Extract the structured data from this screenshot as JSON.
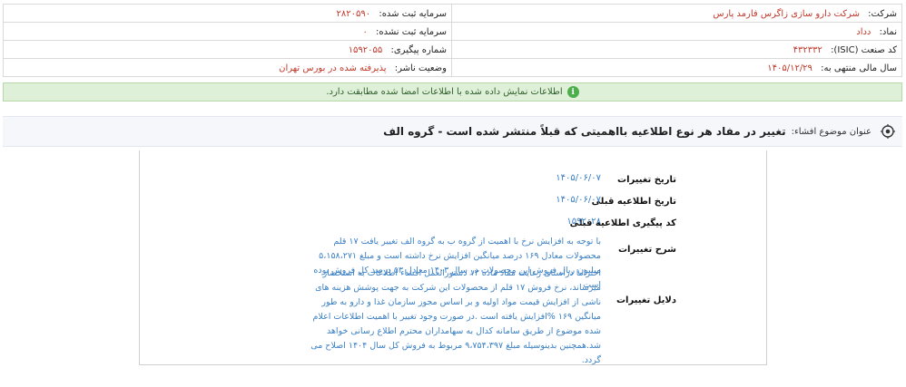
{
  "company_info": {
    "company_label": "شرکت:",
    "company_value": "شرکت دارو سازی زاگرس فارمد پارس",
    "registered_capital_label": "سرمایه ثبت شده:",
    "registered_capital_value": "۲۸۲۰۵۹۰",
    "symbol_label": "نماد:",
    "symbol_value": "دداد",
    "unregistered_capital_label": "سرمایه ثبت نشده:",
    "unregistered_capital_value": "۰",
    "isic_label": "کد صنعت (ISIC):",
    "isic_value": "۴۳۲۳۳۲",
    "tracking_label": "شماره پیگیری:",
    "tracking_value": "۱۵۹۲۰۵۵",
    "fiscal_year_label": "سال مالی منتهی به:",
    "fiscal_year_value": "۱۴۰۵/۱۲/۲۹",
    "publisher_status_label": "وضعیت ناشر:",
    "publisher_status_value": "پذیرفته شده در بورس تهران"
  },
  "notice": {
    "icon": "info-icon",
    "text": "اطلاعات نمایش داده شده با اطلاعات امضا شده مطابقت دارد."
  },
  "subject": {
    "label": "عنوان موضوع افشاء:",
    "title": "تغییر در مفاد هر نوع اطلاعیه بااهمیتی که قبلاً منتشر شده است - گروه الف"
  },
  "details": {
    "change_date_label": "تاریخ تغییرات",
    "change_date_value": "۱۴۰۵/۰۶/۰۷",
    "prev_notice_date_label": "تاریخ اطلاعیه قبلی",
    "prev_notice_date_value": "۱۴۰۵/۰۶/۰۷",
    "prev_tracking_label": "کد پیگیری اطلاعیه قبلی",
    "prev_tracking_value": "۱۵۹۲۰۲۸",
    "description_label": "شرح تغییرات",
    "description_text": "با توجه به افزایش نرخ با اهمیت از گروه ب به گروه الف تغییر یافت ۱۷ قلم محصولات معادل ۱۶۹ درصد میانگین افزایش نرخ داشته است و مبلغ ۵،۱۵۸،۲۷۱ میلیون ریال فروش این محصولات در سال ۱۴۰۳ معادل ۵۳ درصد کل فروش بوده است",
    "reasons_label": "دلایل تغییرات",
    "reasons_text": "احتراما دراستای رعایت مفاد ماده ۱۳ دستورالعمل افشاء اطلاعات به استحضار میرساند، نرخ فروش ۱۷ قلم از محصولات این شرکت به جهت پوشش هزینه های ناشی از افزایش قیمت مواد اولیه و بر اساس مجوز سازمان غذا و دارو به طور میانگین ۱۶۹ %افزایش یافته است .در صورت وجود تغییر با اهمیت اطلاعات اعلام شده موضوع از طریق سامانه کدال به سهامداران محترم اطلاع رسانی خواهد شد.همچنین بدینوسیله مبلغ ۹،۷۵۴،۳۹۷ مربوط به فروش کل سال ۱۴۰۴ اصلاح می گردد."
  }
}
